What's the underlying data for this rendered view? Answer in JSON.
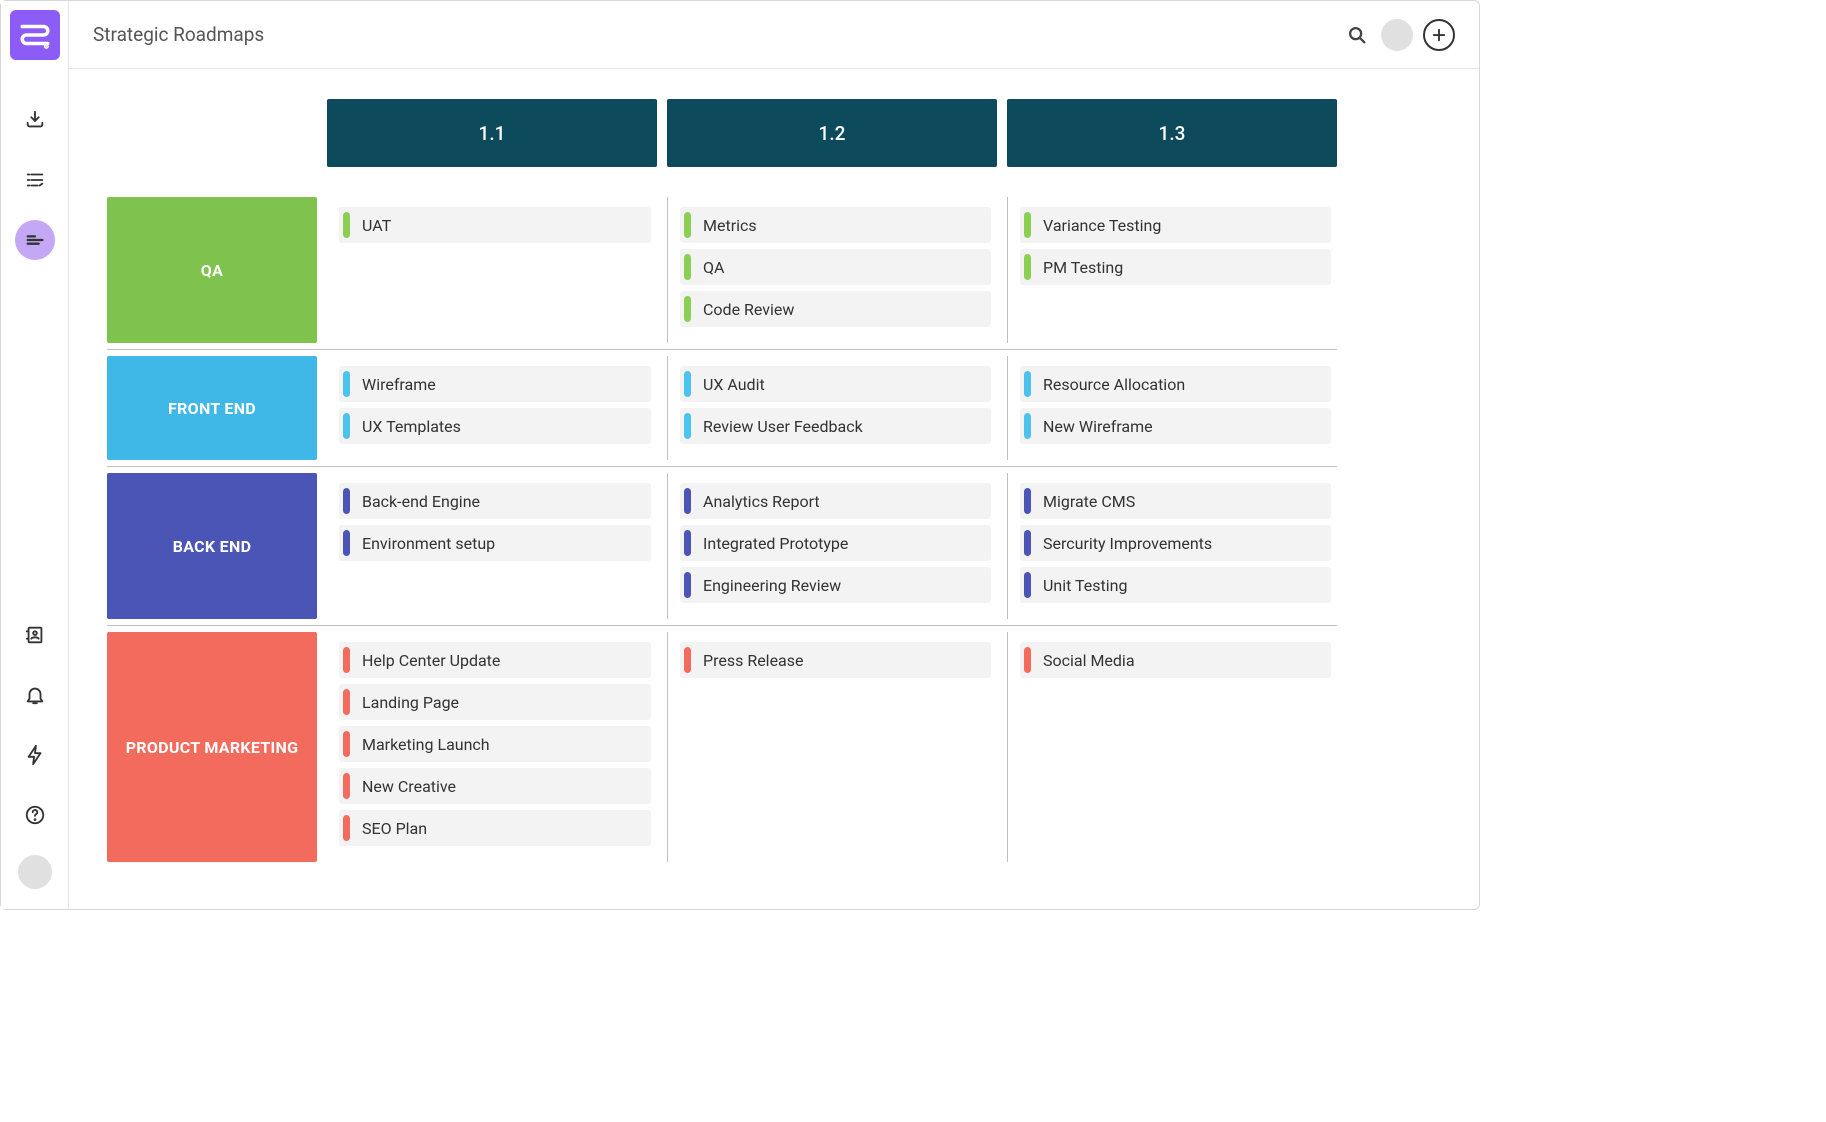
{
  "header": {
    "title": "Strategic Roadmaps"
  },
  "columns": [
    "1.1",
    "1.2",
    "1.3"
  ],
  "lanes": [
    {
      "name": "QA",
      "color": "#7fc24d",
      "stripe": "#8bd054",
      "cells": [
        [
          "UAT"
        ],
        [
          "Metrics",
          "QA",
          "Code Review"
        ],
        [
          "Variance Testing",
          "PM Testing"
        ]
      ]
    },
    {
      "name": "FRONT END",
      "color": "#3fb8e8",
      "stripe": "#4cc3ef",
      "cells": [
        [
          "Wireframe",
          "UX Templates"
        ],
        [
          "UX Audit",
          "Review User Feedback"
        ],
        [
          "Resource Allocation",
          "New Wireframe"
        ]
      ]
    },
    {
      "name": "BACK END",
      "color": "#4a55b5",
      "stripe": "#4a55b5",
      "cells": [
        [
          "Back-end Engine",
          "Environment setup"
        ],
        [
          "Analytics Report",
          "Integrated Prototype",
          "Engineering Review"
        ],
        [
          "Migrate CMS",
          "Sercurity Improvements",
          "Unit Testing"
        ]
      ]
    },
    {
      "name": "PRODUCT MARKETING",
      "color": "#f36b5c",
      "stripe": "#f36b5c",
      "cells": [
        [
          "Help Center Update",
          "Landing Page",
          "Marketing Launch",
          "New Creative",
          "SEO Plan"
        ],
        [
          "Press Release"
        ],
        [
          "Social Media"
        ]
      ]
    }
  ]
}
